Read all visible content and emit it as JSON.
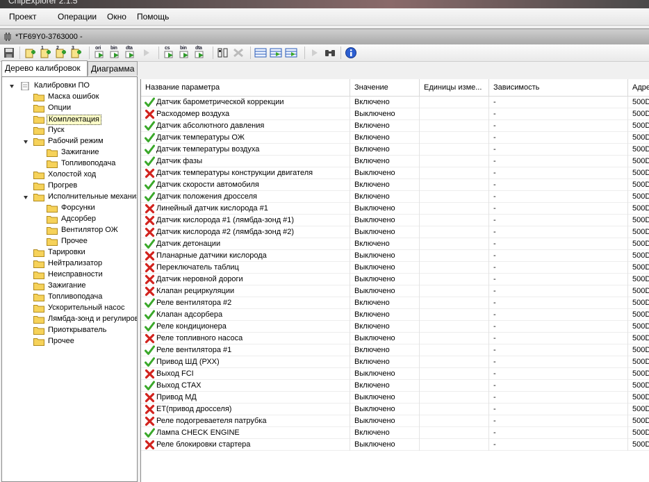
{
  "app": {
    "title": "ChipExplorer 2.1.5"
  },
  "menu": [
    "Проект",
    "Операции",
    "Окно",
    "Помощь"
  ],
  "document": {
    "title": "*TF69Y0-3763000 -"
  },
  "toolbar": {
    "buttons": [
      {
        "name": "save-icon",
        "cap": ""
      },
      {
        "name": "new-icon",
        "cap": ""
      },
      {
        "name": "new-1-icon",
        "cap": "1"
      },
      {
        "name": "new-2-icon",
        "cap": "2"
      },
      {
        "name": "new-3-icon",
        "cap": "3"
      },
      {
        "name": "ori-icon",
        "cap": "ori"
      },
      {
        "name": "bin-icon",
        "cap": "bin"
      },
      {
        "name": "dta-icon",
        "cap": "dta"
      },
      {
        "name": "pointer-icon",
        "cap": ""
      },
      {
        "name": "cs-icon",
        "cap": "cs"
      },
      {
        "name": "bin2-icon",
        "cap": "bin"
      },
      {
        "name": "dta2-icon",
        "cap": "dta"
      },
      {
        "name": "compare-icon",
        "cap": ""
      },
      {
        "name": "disabled-icon",
        "cap": ""
      },
      {
        "name": "table-icon",
        "cap": ""
      },
      {
        "name": "table-export-icon",
        "cap": ""
      },
      {
        "name": "table-import-icon",
        "cap": ""
      },
      {
        "name": "chart-icon",
        "cap": ""
      },
      {
        "name": "binoculars-icon",
        "cap": ""
      },
      {
        "name": "info-icon",
        "cap": ""
      }
    ]
  },
  "tabs": [
    "Дерево калибровок",
    "Диаграмма"
  ],
  "tree": {
    "root": "Калибровки ПО",
    "items": [
      {
        "label": "Маска ошибок",
        "level": 1
      },
      {
        "label": "Опции",
        "level": 1
      },
      {
        "label": "Комплектация",
        "level": 1,
        "selected": true
      },
      {
        "label": "Пуск",
        "level": 1
      },
      {
        "label": "Рабочий режим",
        "level": 1,
        "expanded": true
      },
      {
        "label": "Зажигание",
        "level": 2
      },
      {
        "label": "Топливоподача",
        "level": 2
      },
      {
        "label": "Холостой ход",
        "level": 1
      },
      {
        "label": "Прогрев",
        "level": 1
      },
      {
        "label": "Исполнительные механизмы",
        "level": 1,
        "expanded": true
      },
      {
        "label": "Форсунки",
        "level": 2
      },
      {
        "label": "Адсорбер",
        "level": 2
      },
      {
        "label": "Вентилятор ОЖ",
        "level": 2
      },
      {
        "label": "Прочее",
        "level": 2
      },
      {
        "label": "Тарировки",
        "level": 1
      },
      {
        "label": "Нейтрализатор",
        "level": 1
      },
      {
        "label": "Неисправности",
        "level": 1
      },
      {
        "label": "Зажигание",
        "level": 1
      },
      {
        "label": "Топливоподача",
        "level": 1
      },
      {
        "label": "Ускорительный насос",
        "level": 1
      },
      {
        "label": "Лямбда-зонд и регулирование",
        "level": 1
      },
      {
        "label": "Приоткрыватель",
        "level": 1
      },
      {
        "label": "Прочее",
        "level": 1
      }
    ]
  },
  "table": {
    "columns": [
      "Название параметра",
      "Значение",
      "Единицы изме...",
      "Зависимость",
      "Адре"
    ],
    "rows": [
      {
        "name": "Датчик барометрической коррекции",
        "value": "Включено",
        "dep": "-",
        "addr": "500D",
        "on": true
      },
      {
        "name": "Расходомер воздуха",
        "value": "Выключено",
        "dep": "-",
        "addr": "500D",
        "on": false
      },
      {
        "name": "Датчик абсолютного давления",
        "value": "Включено",
        "dep": "-",
        "addr": "500D",
        "on": true
      },
      {
        "name": "Датчик температуры ОЖ",
        "value": "Включено",
        "dep": "-",
        "addr": "500D",
        "on": true
      },
      {
        "name": "Датчик температуры воздуха",
        "value": "Включено",
        "dep": "-",
        "addr": "500D",
        "on": true
      },
      {
        "name": "Датчик фазы",
        "value": "Включено",
        "dep": "-",
        "addr": "500D",
        "on": true
      },
      {
        "name": "Датчик температуры конструкции двигателя",
        "value": "Выключено",
        "dep": "-",
        "addr": "500D",
        "on": false
      },
      {
        "name": "Датчик скорости автомобиля",
        "value": "Включено",
        "dep": "-",
        "addr": "500D",
        "on": true
      },
      {
        "name": "Датчик положения дросселя",
        "value": "Включено",
        "dep": "-",
        "addr": "500D",
        "on": true
      },
      {
        "name": "Линейный датчик кислорода #1",
        "value": "Выключено",
        "dep": "-",
        "addr": "500D",
        "on": false
      },
      {
        "name": "Датчик кислорода #1 (лямбда-зонд #1)",
        "value": "Выключено",
        "dep": "-",
        "addr": "500D",
        "on": false
      },
      {
        "name": "Датчик кислорода #2 (лямбда-зонд #2)",
        "value": "Выключено",
        "dep": "-",
        "addr": "500D",
        "on": false
      },
      {
        "name": "Датчик детонации",
        "value": "Включено",
        "dep": "-",
        "addr": "500D",
        "on": true
      },
      {
        "name": "Планарные датчики кислорода",
        "value": "Выключено",
        "dep": "-",
        "addr": "500D",
        "on": false
      },
      {
        "name": "Переключатель таблиц",
        "value": "Выключено",
        "dep": "-",
        "addr": "500D",
        "on": false
      },
      {
        "name": "Датчик неровной дороги",
        "value": "Выключено",
        "dep": "-",
        "addr": "500D",
        "on": false
      },
      {
        "name": "Клапан рециркуляции",
        "value": "Выключено",
        "dep": "-",
        "addr": "500D",
        "on": false
      },
      {
        "name": "Реле вентилятора #2",
        "value": "Включено",
        "dep": "-",
        "addr": "500D",
        "on": true
      },
      {
        "name": "Клапан адсорбера",
        "value": "Включено",
        "dep": "-",
        "addr": "500D",
        "on": true
      },
      {
        "name": "Реле кондиционера",
        "value": "Включено",
        "dep": "-",
        "addr": "500D",
        "on": true
      },
      {
        "name": "Реле топливного насоса",
        "value": "Выключено",
        "dep": "-",
        "addr": "500D",
        "on": false
      },
      {
        "name": "Реле вентилятора #1",
        "value": "Включено",
        "dep": "-",
        "addr": "500D",
        "on": true
      },
      {
        "name": "Привод ШД (РХХ)",
        "value": "Включено",
        "dep": "-",
        "addr": "500D",
        "on": true
      },
      {
        "name": "Выход FCI",
        "value": "Выключено",
        "dep": "-",
        "addr": "500D",
        "on": false
      },
      {
        "name": "Выход CTAX",
        "value": "Включено",
        "dep": "-",
        "addr": "500D",
        "on": true
      },
      {
        "name": "Привод МД",
        "value": "Выключено",
        "dep": "-",
        "addr": "500D",
        "on": false
      },
      {
        "name": "ET(привод дросселя)",
        "value": "Выключено",
        "dep": "-",
        "addr": "500D",
        "on": false
      },
      {
        "name": "Реле подогреваетеля патрубка",
        "value": "Выключено",
        "dep": "-",
        "addr": "500D",
        "on": false
      },
      {
        "name": "Лампа CHECK ENGINE",
        "value": "Включено",
        "dep": "-",
        "addr": "500D",
        "on": true
      },
      {
        "name": "Реле блокировки стартера",
        "value": "Выключено",
        "dep": "-",
        "addr": "500D",
        "on": false
      }
    ]
  },
  "colors": {
    "check": "#3aa82a",
    "cross": "#d2231e",
    "folder": "#f6d25a",
    "selected": "#ffffc8"
  }
}
